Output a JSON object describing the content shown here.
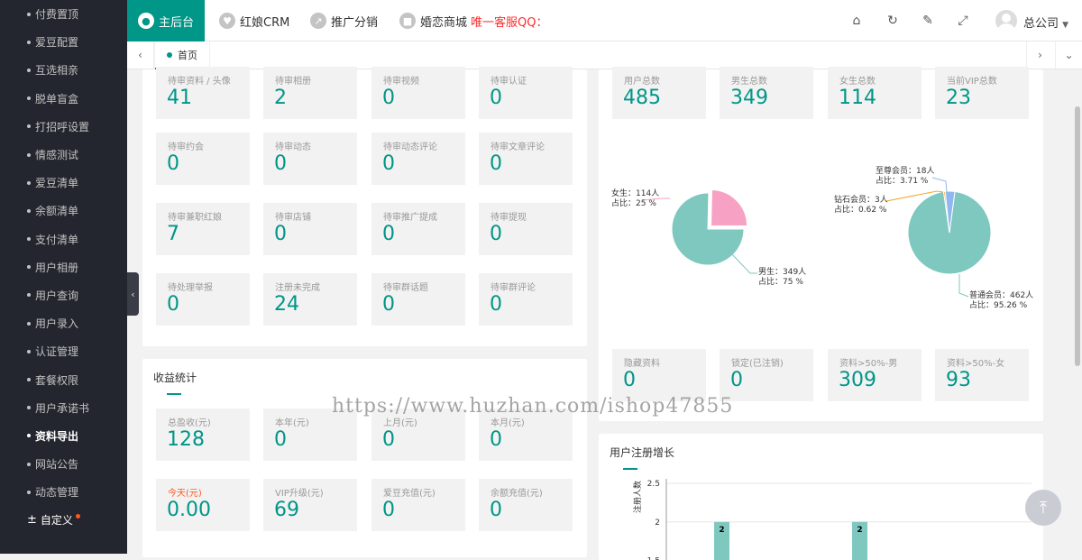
{
  "sidebar": {
    "items": [
      {
        "label": "付费置顶"
      },
      {
        "label": "爱豆配置"
      },
      {
        "label": "互选相亲"
      },
      {
        "label": "脱单盲盒"
      },
      {
        "label": "打招呼设置"
      },
      {
        "label": "情感测试"
      },
      {
        "label": "爱豆清单"
      },
      {
        "label": "余额清单"
      },
      {
        "label": "支付清单"
      },
      {
        "label": "用户相册"
      },
      {
        "label": "用户查询"
      },
      {
        "label": "用户录入"
      },
      {
        "label": "认证管理"
      },
      {
        "label": "套餐权限"
      },
      {
        "label": "用户承诺书"
      },
      {
        "label": "资料导出"
      },
      {
        "label": "网站公告"
      },
      {
        "label": "动态管理"
      },
      {
        "label": "自定义"
      }
    ]
  },
  "topbar": {
    "tabs": [
      {
        "label": "主后台"
      },
      {
        "label": "红娘CRM"
      },
      {
        "label": "推广分销"
      },
      {
        "label": "婚恋商城"
      }
    ],
    "warning": "唯一客服QQ：",
    "user": "总公司"
  },
  "tabsbar": {
    "home": "首页"
  },
  "review": {
    "cards": [
      {
        "label": "待审资料 / 头像",
        "value": "41"
      },
      {
        "label": "待审相册",
        "value": "2"
      },
      {
        "label": "待审视频",
        "value": "0"
      },
      {
        "label": "待审认证",
        "value": "0"
      },
      {
        "label": "待审约会",
        "value": "0"
      },
      {
        "label": "待审动态",
        "value": "0"
      },
      {
        "label": "待审动态评论",
        "value": "0"
      },
      {
        "label": "待审文章评论",
        "value": "0"
      },
      {
        "label": "待审兼职红娘",
        "value": "7"
      },
      {
        "label": "待审店铺",
        "value": "0"
      },
      {
        "label": "待审推广提成",
        "value": "0"
      },
      {
        "label": "待审提现",
        "value": "0"
      },
      {
        "label": "待处理举报",
        "value": "0"
      },
      {
        "label": "注册未完成",
        "value": "24"
      },
      {
        "label": "待审群话题",
        "value": "0"
      },
      {
        "label": "待审群评论",
        "value": "0"
      }
    ]
  },
  "income": {
    "title": "收益统计",
    "cards": [
      {
        "label": "总盈收(元)",
        "value": "128"
      },
      {
        "label": "本年(元)",
        "value": "0"
      },
      {
        "label": "上月(元)",
        "value": "0"
      },
      {
        "label": "本月(元)",
        "value": "0"
      },
      {
        "label": "今天(元)",
        "value": "0.00",
        "highlight": "#ff5722"
      },
      {
        "label": "VIP升级(元)",
        "value": "69"
      },
      {
        "label": "爱豆充值(元)",
        "value": "0"
      },
      {
        "label": "余额充值(元)",
        "value": "0"
      }
    ]
  },
  "users": {
    "top": [
      {
        "label": "用户总数",
        "value": "485"
      },
      {
        "label": "男生总数",
        "value": "349"
      },
      {
        "label": "女生总数",
        "value": "114"
      },
      {
        "label": "当前VIP总数",
        "value": "23"
      }
    ],
    "bottom": [
      {
        "label": "隐藏资料",
        "value": "0"
      },
      {
        "label": "锁定(已注销)",
        "value": "0"
      },
      {
        "label": "资料>50%-男",
        "value": "309"
      },
      {
        "label": "资料>50%-女",
        "value": "93"
      }
    ]
  },
  "chart_data": [
    {
      "type": "pie",
      "slices": [
        {
          "name": "男生",
          "value": 349,
          "percent": "75 %",
          "color": "#7ec8bf",
          "line1": "男生：349人",
          "line2": "占比：75 %"
        },
        {
          "name": "女生",
          "value": 114,
          "percent": "25 %",
          "color": "#f7a1c4",
          "line1": "女生：114人",
          "line2": "占比：25 %"
        }
      ]
    },
    {
      "type": "pie",
      "slices": [
        {
          "name": "普通会员",
          "value": 462,
          "percent": "95.26 %",
          "color": "#7ec8bf",
          "line1": "普通会员：462人",
          "line2": "占比：95.26 %"
        },
        {
          "name": "钻石会员",
          "value": 3,
          "percent": "0.62 %",
          "color": "#f5a623",
          "line1": "钻石会员：3人",
          "line2": "占比：0.62 %"
        },
        {
          "name": "至尊会员",
          "value": 18,
          "percent": "3.71 %",
          "color": "#8fb8ee",
          "line1": "至尊会员：18人",
          "line2": "占比：3.71 %"
        }
      ]
    },
    {
      "type": "bar",
      "title": "用户注册增长",
      "ylabel": "注册人数",
      "yticks": [
        "2.5",
        "2",
        "1.5"
      ],
      "ylim": [
        1.25,
        2.5
      ],
      "values": [
        2,
        2
      ],
      "bar_color": "#7ec8bf"
    }
  ],
  "watermark": "https://www.huzhan.com/ishop47855"
}
